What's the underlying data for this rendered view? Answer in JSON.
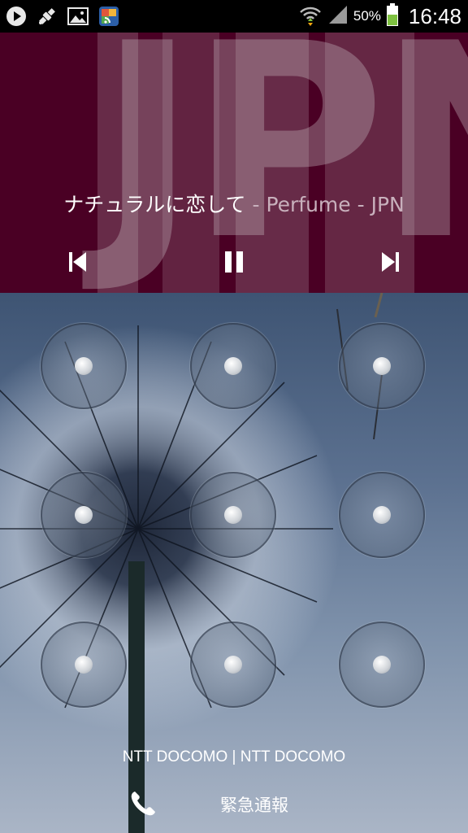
{
  "status_bar": {
    "left_icons": [
      "play-icon",
      "satellite-icon",
      "picture-icon",
      "rss-feed-icon"
    ],
    "right_icons": [
      "wifi-icon",
      "signal-icon",
      "battery-icon"
    ],
    "battery_percent": "50%",
    "time": "16:48"
  },
  "music": {
    "album_art_text": "JPN",
    "song_title": "ナチュラルに恋して",
    "artist_info": " - Perfume - JPN",
    "controls": [
      "previous-icon",
      "pause-icon",
      "next-icon"
    ],
    "background_color": "#4a0024"
  },
  "lock": {
    "pattern_nodes": 9,
    "carrier": "NTT DOCOMO | NTT DOCOMO",
    "emergency_label": "緊急通報"
  }
}
